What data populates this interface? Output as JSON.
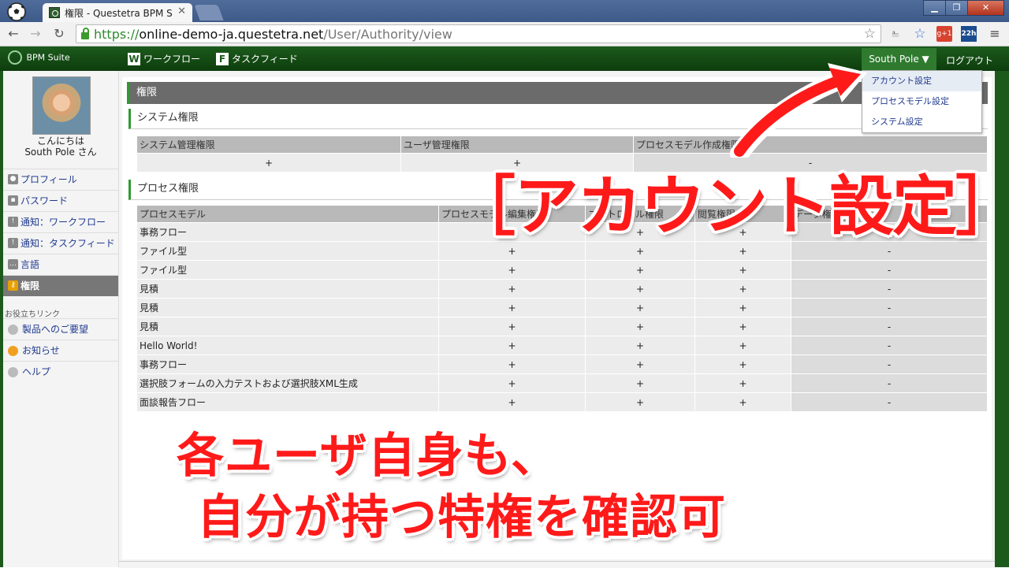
{
  "browser": {
    "tab_title": "権限 - Questetra BPM S",
    "url_scheme": "https://",
    "url_host": "online-demo-ja.questetra.net",
    "url_path": "/User/Authority/view",
    "ext_badge": "22h",
    "ext_gplus": "g+1"
  },
  "app": {
    "brand": "BPM Suite",
    "nav": [
      {
        "badge": "W",
        "label": "ワークフロー"
      },
      {
        "badge": "F",
        "label": "タスクフィード"
      }
    ],
    "user_button": "South Pole ▼",
    "logout": "ログアウト",
    "dropdown": [
      "アカウント設定",
      "プロセスモデル設定",
      "システム設定"
    ]
  },
  "sidebar": {
    "greeting_line1": "こんにちは",
    "greeting_line2": "South Pole さん",
    "menu": [
      "プロフィール",
      "パスワード",
      "通知：ワークフロー",
      "通知：タスクフィード",
      "言語",
      "権限"
    ],
    "helpful_heading": "お役立ちリンク",
    "links": [
      "製品へのご要望",
      "お知らせ",
      "ヘルプ"
    ]
  },
  "main": {
    "heading": "権限",
    "system": {
      "title": "システム権限",
      "headers": [
        "システム管理権限",
        "ユーザ管理権限",
        "プロセスモデル作成権限"
      ],
      "values": [
        "+",
        "+",
        "-"
      ]
    },
    "process": {
      "title": "プロセス権限",
      "headers": [
        "プロセスモデル",
        "プロセスモデル編集権限",
        "コントロール権限",
        "閲覧権限",
        "データ権限"
      ],
      "rows": [
        {
          "name": "事務フロー",
          "cells": [
            "+",
            "+",
            "+",
            "-"
          ]
        },
        {
          "name": "ファイル型",
          "cells": [
            "+",
            "+",
            "+",
            "-"
          ]
        },
        {
          "name": "ファイル型",
          "cells": [
            "+",
            "+",
            "+",
            "-"
          ]
        },
        {
          "name": "見積",
          "cells": [
            "+",
            "+",
            "+",
            "-"
          ]
        },
        {
          "name": "見積",
          "cells": [
            "+",
            "+",
            "+",
            "-"
          ]
        },
        {
          "name": "見積",
          "cells": [
            "+",
            "+",
            "+",
            "-"
          ]
        },
        {
          "name": "Hello World!",
          "cells": [
            "+",
            "+",
            "+",
            "-"
          ]
        },
        {
          "name": "事務フロー",
          "cells": [
            "+",
            "+",
            "+",
            "-"
          ]
        },
        {
          "name": "選択肢フォームの入力テストおよび選択肢XML生成",
          "cells": [
            "+",
            "+",
            "+",
            "-"
          ]
        },
        {
          "name": "面談報告フロー",
          "cells": [
            "+",
            "+",
            "+",
            "-"
          ]
        }
      ]
    }
  },
  "overlay": {
    "callout": "［アカウント設定］",
    "caption_line1": "各ユーザ自身も、",
    "caption_line2": "自分が持つ特権を確認可"
  },
  "colors": {
    "accent_red": "#ff1a1a",
    "app_green": "#1c5a1c",
    "active_gray": "#777777"
  }
}
